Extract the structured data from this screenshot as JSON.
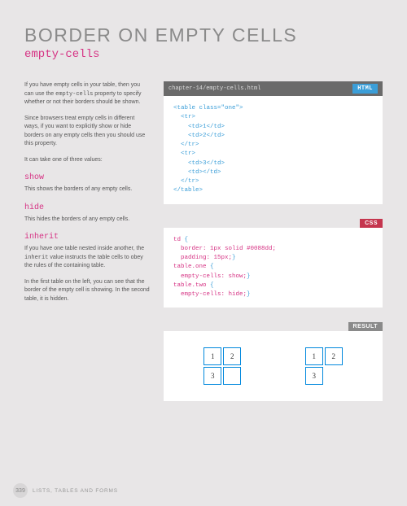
{
  "title": "BORDER ON EMPTY CELLS",
  "subtitle": "empty-cells",
  "left": {
    "p1": "If you have empty cells in your table, then you can use the ",
    "p1_code": "empty-cells",
    "p1_end": " property to specify whether or not their borders should be shown.",
    "p2": "Since browsers treat empty cells in different ways, if you want to explicitly show or hide borders on any empty cells then you should use this property.",
    "p3": "It can take one of three values:",
    "show_label": "show",
    "show_desc": "This shows the borders of any empty cells.",
    "hide_label": "hide",
    "hide_desc": "This hides the borders of any empty cells.",
    "inherit_label": "inherit",
    "inherit_desc_a": "If you have one table nested inside another, the ",
    "inherit_code": "inherit",
    "inherit_desc_b": " value instructs the table cells to obey the rules of the containing table.",
    "p_final": "In the first table on the left, you can see that the border of the empty cell is showing. In the second table, it is hidden."
  },
  "code_header_path": "chapter-14/empty-cells.html",
  "badge_html": "HTML",
  "badge_css": "CSS",
  "badge_result": "RESULT",
  "html_code": "<table class=\"one\">\n  <tr>\n    <td>1</td>\n    <td>2</td>\n  </tr>\n  <tr>\n    <td>3</td>\n    <td></td>\n  </tr>\n</table>",
  "css_code": "td {\n  border: 1px solid #0088dd;\n  padding: 15px;}\ntable.one {\n  empty-cells: show;}\ntable.two {\n  empty-cells: hide;}",
  "demo": {
    "c1": "1",
    "c2": "2",
    "c3": "3"
  },
  "footer": {
    "page": "339",
    "section": "LISTS, TABLES AND FORMS"
  }
}
